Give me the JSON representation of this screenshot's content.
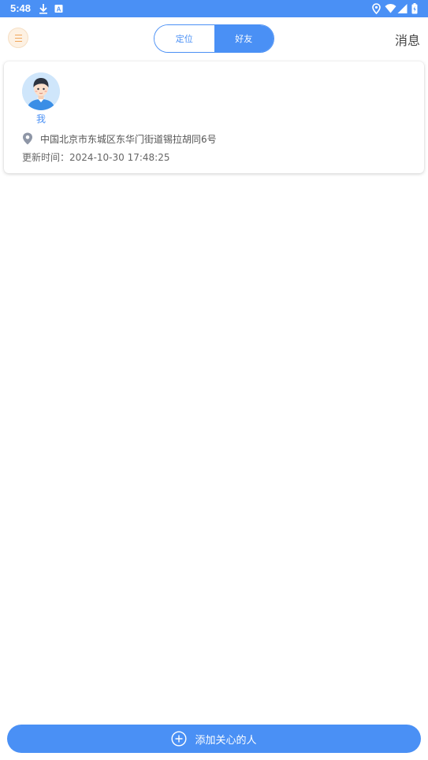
{
  "status_bar": {
    "time": "5:48",
    "icons": [
      "download-icon",
      "a-badge-icon",
      "location-icon",
      "wifi-icon",
      "signal-icon",
      "battery-icon"
    ]
  },
  "header": {
    "menu_icon": "menu-icon",
    "tabs": [
      {
        "label": "定位",
        "active": false
      },
      {
        "label": "好友",
        "active": true
      }
    ],
    "messages_label": "消息"
  },
  "friend_card": {
    "name": "我",
    "address": "中国北京市东城区东华门街道锡拉胡同6号",
    "update_label": "更新时间",
    "update_time": "2024-10-30 17:48:25"
  },
  "footer": {
    "add_button_label": "添加关心的人"
  },
  "colors": {
    "accent": "#4a90f5",
    "menu_bg": "#fdf1e3",
    "menu_lines": "#f1a65b"
  }
}
